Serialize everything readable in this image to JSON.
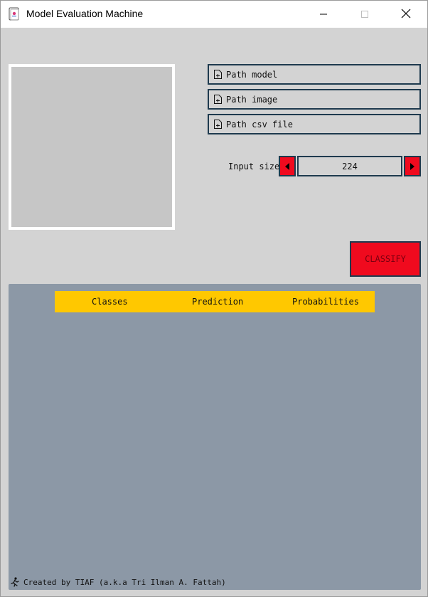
{
  "window": {
    "title": "Model Evaluation Machine",
    "app_icon": "card-app-icon"
  },
  "controls": {
    "minimize_icon": "minimize-icon",
    "maximize_icon": "maximize-icon",
    "close_icon": "close-icon"
  },
  "paths": {
    "model_label": "Path model",
    "image_label": "Path image",
    "csv_label": "Path csv file",
    "icon": "file-add-icon"
  },
  "input_size": {
    "label": "Input size:",
    "value": "224",
    "decrement_icon": "triangle-left-icon",
    "increment_icon": "triangle-right-icon"
  },
  "classify": {
    "label": "CLASSIFY"
  },
  "results": {
    "columns": [
      "Classes",
      "Prediction",
      "Probabilities"
    ],
    "rows": []
  },
  "footer": {
    "text": "Created by TIAF (a.k.a Tri Ilman A. Fattah)",
    "icon": "running-person-icon"
  },
  "colors": {
    "background": "#d3d3d3",
    "accent_red": "#f00a1e",
    "border_navy": "#1e3a4e",
    "header_yellow": "#ffc800",
    "panel_slate": "#8c98a6"
  }
}
